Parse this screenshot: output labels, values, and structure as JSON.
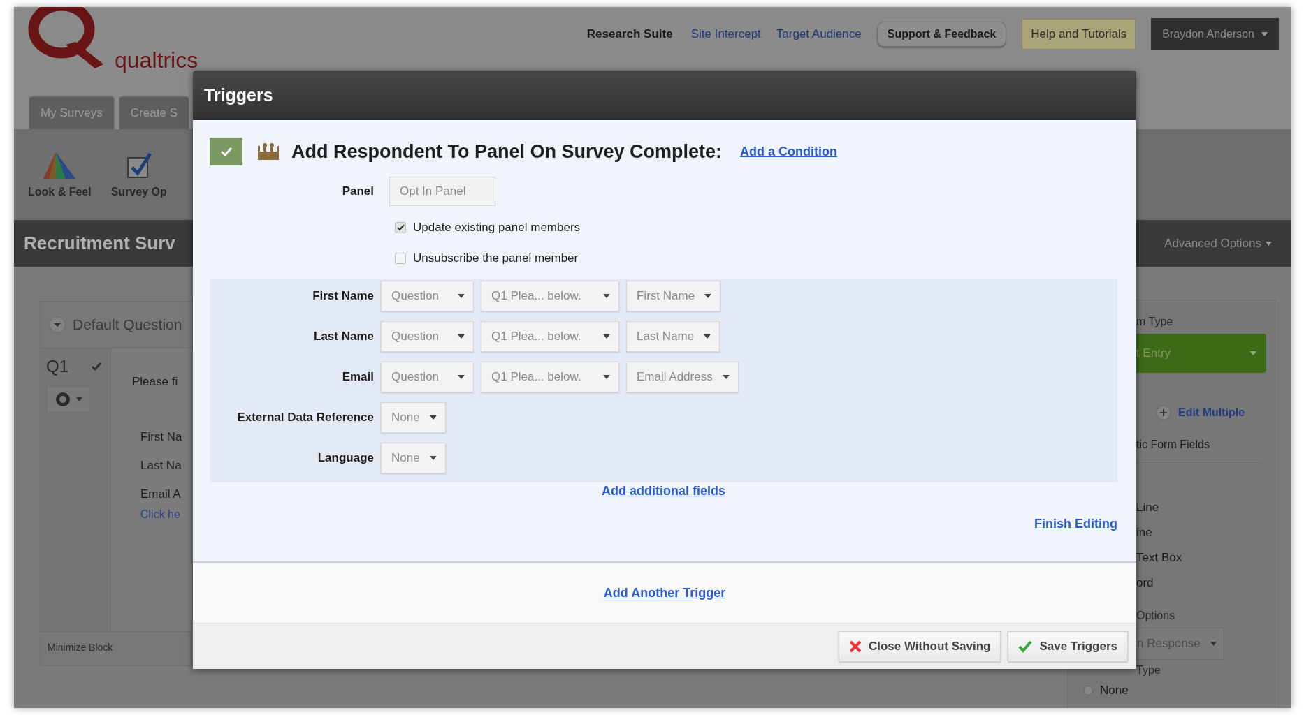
{
  "app": {
    "logo": "qualtrics",
    "top_nav": [
      {
        "label": "Research Suite",
        "kind": "current"
      },
      {
        "label": "Site Intercept",
        "kind": "link"
      },
      {
        "label": "Target Audience",
        "kind": "link"
      },
      {
        "label": "Support & Feedback",
        "kind": "button"
      },
      {
        "label": "Help and Tutorials",
        "kind": "highlight"
      }
    ],
    "user_menu": "Braydon Anderson",
    "tabs": [
      "My Surveys",
      "Create S"
    ],
    "toolbar": [
      {
        "label": "Look & Feel",
        "kind": "palette"
      },
      {
        "label": "Survey Op",
        "kind": "check"
      }
    ],
    "survey_title": "Recruitment Surv",
    "advanced_options": "Advanced Options",
    "block": {
      "title": "Default Question",
      "number": "Q1",
      "question": "Please fi",
      "fields": [
        "First Na",
        "Last Na",
        "Email A"
      ],
      "link": "Click he",
      "minimize": "Minimize Block"
    },
    "side_panel": [
      {
        "kind": "label",
        "text": "m Type"
      },
      {
        "kind": "green-dropdown",
        "text": "t Entry"
      },
      {
        "kind": "add-link",
        "text": "Edit Multiple"
      },
      {
        "kind": "section-title",
        "text": "tic Form Fields"
      },
      {
        "kind": "list-item",
        "text": "Line"
      },
      {
        "kind": "list-item",
        "text": "ine"
      },
      {
        "kind": "list-item",
        "text": "Text Box"
      },
      {
        "kind": "list-item",
        "text": "ord"
      },
      {
        "kind": "label",
        "text": "Options"
      },
      {
        "kind": "dropdown",
        "text": "n Response"
      },
      {
        "kind": "label",
        "text": "Type"
      },
      {
        "kind": "radio",
        "text": "None",
        "selected": false
      }
    ]
  },
  "dialog": {
    "title": "Triggers",
    "trigger": {
      "enabled": true,
      "title": "Add Respondent To Panel On Survey Complete:",
      "add_condition": "Add a Condition"
    },
    "panel": {
      "label": "Panel",
      "value": "Opt In Panel"
    },
    "options": [
      {
        "label": "Update existing panel members",
        "checked": true
      },
      {
        "label": "Unsubscribe the panel member",
        "checked": false
      }
    ],
    "fields": [
      {
        "label": "First Name",
        "dropdowns": [
          "Question",
          "Q1 Plea... below.",
          "First Name"
        ]
      },
      {
        "label": "Last Name",
        "dropdowns": [
          "Question",
          "Q1 Plea... below.",
          "Last Name"
        ]
      },
      {
        "label": "Email",
        "dropdowns": [
          "Question",
          "Q1 Plea... below.",
          "Email Address"
        ]
      },
      {
        "label": "External Data Reference",
        "dropdowns": [
          "None"
        ]
      },
      {
        "label": "Language",
        "dropdowns": [
          "None"
        ]
      }
    ],
    "add_fields": "Add additional fields",
    "finish": "Finish Editing",
    "add_trigger": "Add Another Trigger",
    "buttons": [
      {
        "label": "Close Without Saving",
        "kind": "cancel"
      },
      {
        "label": "Save Triggers",
        "kind": "save"
      }
    ]
  }
}
